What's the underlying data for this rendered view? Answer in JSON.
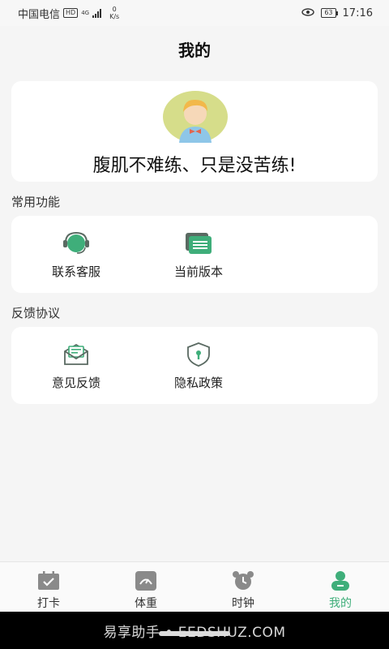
{
  "status_bar": {
    "carrier": "中国电信",
    "hd": "HD",
    "network": "4G",
    "speed_value": "0",
    "speed_unit": "K/s",
    "battery": "63",
    "time": "17:16"
  },
  "header": {
    "title": "我的"
  },
  "profile": {
    "motto": "腹肌不难练、只是没苦练!"
  },
  "sections": {
    "common": {
      "title": "常用功能",
      "items": [
        {
          "label": "联系客服",
          "icon": "headset-icon"
        },
        {
          "label": "当前版本",
          "icon": "version-icon"
        }
      ]
    },
    "feedback": {
      "title": "反馈协议",
      "items": [
        {
          "label": "意见反馈",
          "icon": "mail-icon"
        },
        {
          "label": "隐私政策",
          "icon": "shield-icon"
        }
      ]
    }
  },
  "tabbar": {
    "tabs": [
      {
        "label": "打卡",
        "icon": "calendar-check-icon"
      },
      {
        "label": "体重",
        "icon": "scale-icon"
      },
      {
        "label": "时钟",
        "icon": "alarm-clock-icon"
      },
      {
        "label": "我的",
        "icon": "user-icon",
        "active": true
      }
    ]
  },
  "nav": {
    "watermark": "易享助手 • EEDSHUZ.COM"
  },
  "colors": {
    "accent": "#3fae7a",
    "icon_gray": "#8a8a8a",
    "background": "#f5f5f5"
  }
}
